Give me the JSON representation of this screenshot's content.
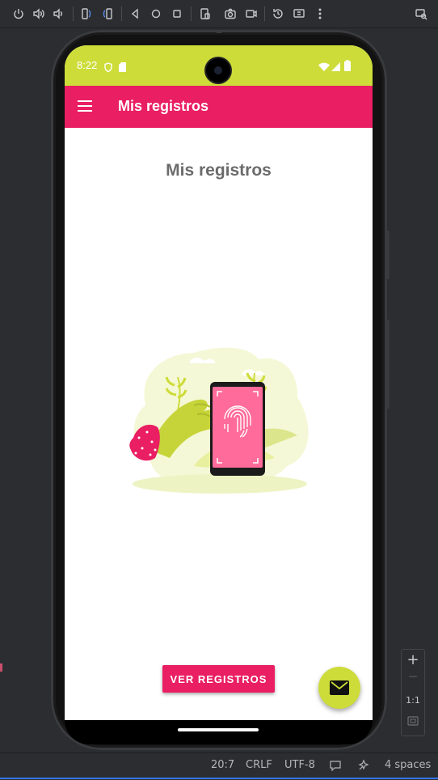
{
  "toolbar": {
    "icons": [
      "power-icon",
      "volume-up-icon",
      "volume-down-icon",
      "rotate-left-icon",
      "rotate-right-icon",
      "back-icon",
      "home-icon",
      "overview-icon",
      "fold-icon",
      "screenshot-icon",
      "screen-record-icon",
      "snapshot-icon",
      "display-mode-icon",
      "more-icon",
      "device-explorer-icon"
    ]
  },
  "device": {
    "status_time": "8:22",
    "appbar_title": "Mis registros"
  },
  "content": {
    "page_title": "Mis registros",
    "button_label": "VER REGISTROS"
  },
  "zoom_panel": {
    "plus": "+",
    "minus": "—",
    "ratio": "1:1"
  },
  "ide_status": {
    "position": "20:7",
    "line_ending": "CRLF",
    "encoding": "UTF-8",
    "indent": "4 spaces"
  },
  "colors": {
    "appbar": "#e91e63",
    "statusbar": "#cddc39",
    "fab": "#cddc39",
    "button": "#e91e63"
  }
}
